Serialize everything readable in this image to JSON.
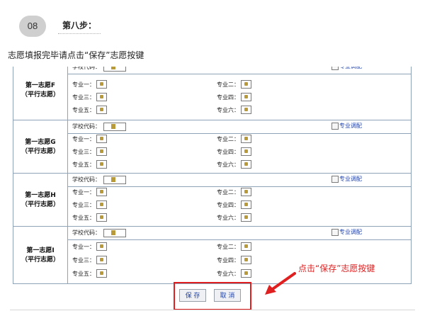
{
  "step": {
    "number": "08",
    "title": "第八步："
  },
  "instruction": "志愿填报完毕请点击“保存”志愿按键",
  "form": {
    "school_code_label": "学校代码：",
    "adjust_label": "专业调配",
    "major_labels": [
      "专业一：",
      "专业二：",
      "专业三：",
      "专业四：",
      "专业五：",
      "专业六："
    ],
    "volunteers": [
      {
        "name": "第一志愿F",
        "type": "（平行志愿）"
      },
      {
        "name": "第一志愿G",
        "type": "（平行志愿）"
      },
      {
        "name": "第一志愿H",
        "type": "（平行志愿）"
      },
      {
        "name": "第一志愿I",
        "type": "（平行志愿）"
      }
    ]
  },
  "buttons": {
    "save": "保 存",
    "cancel": "取 消"
  },
  "annotation": "点击“保存”志愿按键",
  "colors": {
    "highlight": "#e02020",
    "link": "#2244aa",
    "border": "#8fa3b8"
  }
}
